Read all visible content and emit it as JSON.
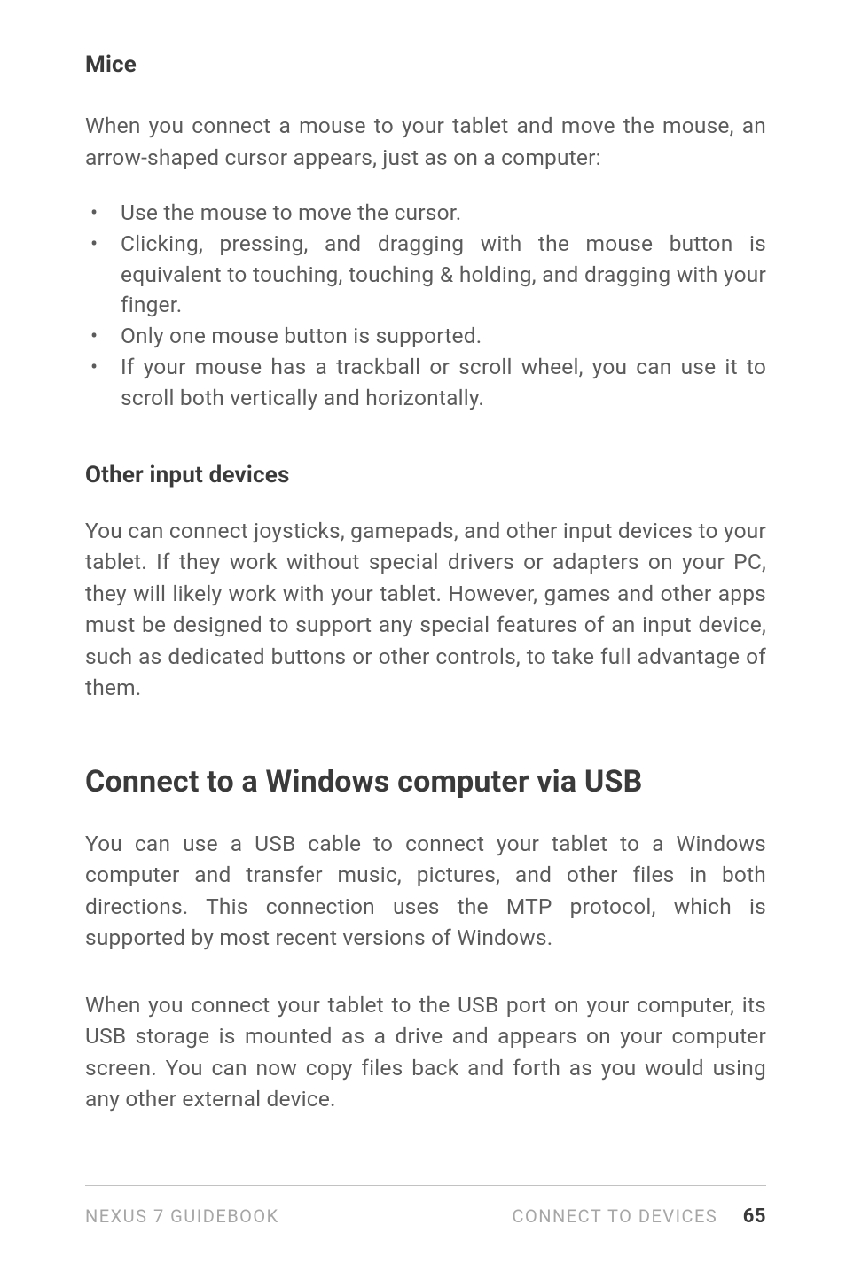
{
  "sections": {
    "mice": {
      "heading": "Mice",
      "intro": "When you connect a mouse to your tablet and move the mouse, an arrow-shaped cursor appears, just as on a computer:",
      "bullets": [
        "Use the mouse to move the cursor.",
        "Clicking, pressing, and dragging with the mouse button is equivalent to touching, touching & holding, and dragging with your finger.",
        "Only one mouse button is supported.",
        "If your mouse has a trackball or scroll wheel, you can use it to scroll both vertically and horizontally."
      ]
    },
    "other": {
      "heading": "Other input devices",
      "para": "You can connect joysticks, gamepads, and other input devices to your tablet. If they work without special drivers or adapters on your PC, they will likely work with your tablet. However, games and other apps must be designed to support any special features of an input device, such as dedicated buttons or other controls, to take full advantage of them."
    },
    "usb": {
      "heading": "Connect to a Windows computer via USB",
      "para1": "You can use a USB cable to connect your tablet to a Windows computer and transfer music, pictures, and other files in both directions. This connection uses the MTP protocol, which is supported by most recent versions of Windows.",
      "para2": "When you connect your tablet to the USB port on your computer, its USB storage is mounted as a drive and appears on your computer screen. You can now copy files back and forth as you would using any other external device."
    }
  },
  "footer": {
    "left": "NEXUS 7 GUIDEBOOK",
    "right": "CONNECT TO DEVICES",
    "page": "65"
  }
}
